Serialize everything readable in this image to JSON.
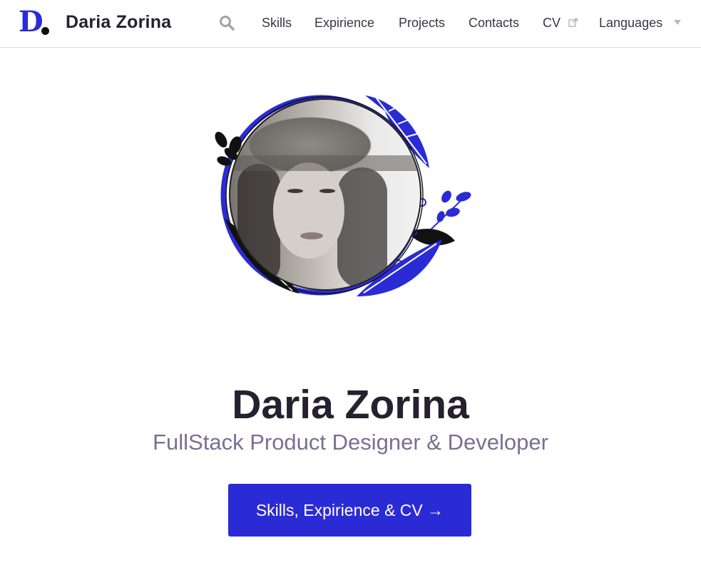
{
  "brand": {
    "logo_letter": "D",
    "name": "Daria Zorina",
    "accent_color": "#2b2bd6"
  },
  "nav": {
    "search_icon": "search-icon",
    "items": [
      {
        "label": "Skills"
      },
      {
        "label": "Expirience"
      },
      {
        "label": "Projects"
      },
      {
        "label": "Contacts"
      },
      {
        "label": "CV",
        "icon": "external-link-icon"
      },
      {
        "label": "Languages",
        "icon": "caret-down-icon"
      }
    ]
  },
  "hero": {
    "name": "Daria Zorina",
    "subtitle": "FullStack Product Designer & Developer",
    "cta_label": "Skills, Expirience & CV →",
    "avatar_icon": "profile-photo"
  }
}
